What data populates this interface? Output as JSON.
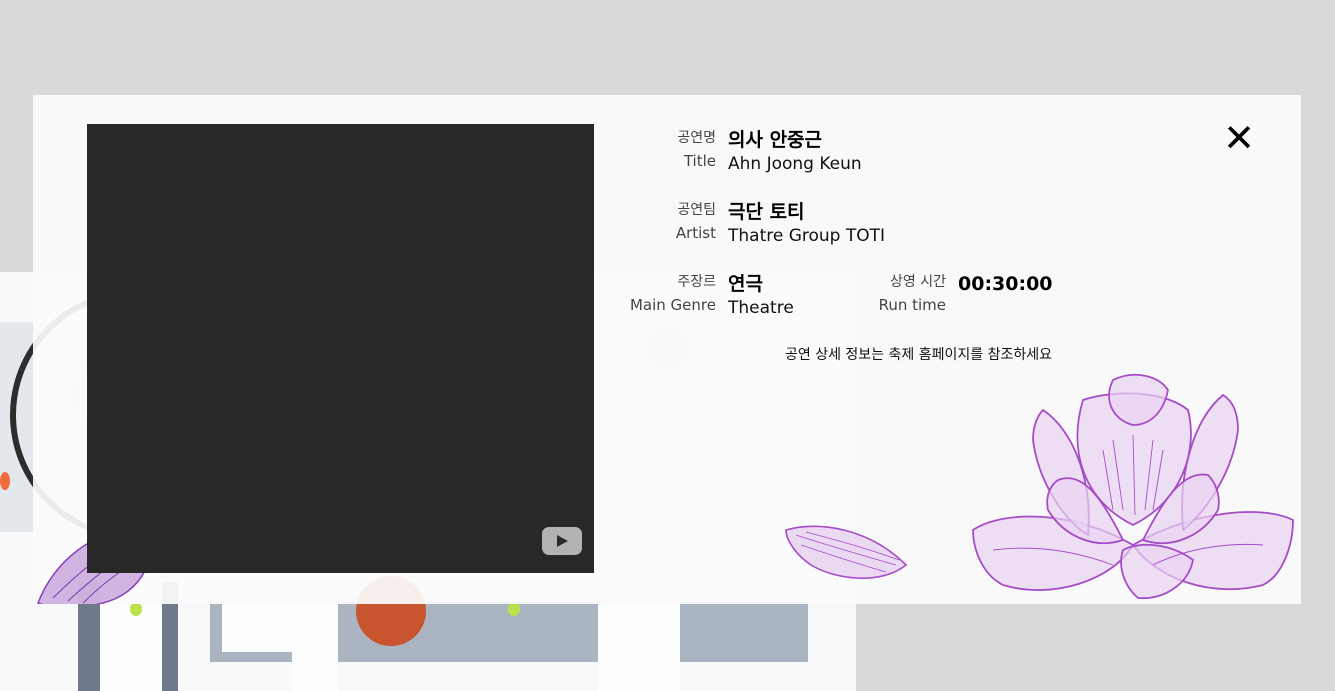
{
  "modal": {
    "close_label": "✕",
    "video": {
      "player_icon": "youtube-play-icon"
    },
    "fields": {
      "title": {
        "label_ko": "공연명",
        "label_en": "Title",
        "value_ko": "의사 안중근",
        "value_en": "Ahn Joong Keun"
      },
      "artist": {
        "label_ko": "공연팀",
        "label_en": "Artist",
        "value_ko": "극단 토티",
        "value_en": "Thatre Group TOTI"
      },
      "genre": {
        "label_ko": "주장르",
        "label_en": "Main Genre",
        "value_ko": "연극",
        "value_en": "Theatre"
      },
      "runtime": {
        "label_ko": "상영 시간",
        "label_en": "Run time",
        "value": "00:30:00"
      }
    },
    "note": "공연 상세 정보는 축제 홈페이지를 참조하세요"
  },
  "colors": {
    "lotus": "#a64cc7",
    "lotus_fill": "#e6cdef",
    "video_bg": "#282828",
    "overlay": "#d9d9d9"
  }
}
